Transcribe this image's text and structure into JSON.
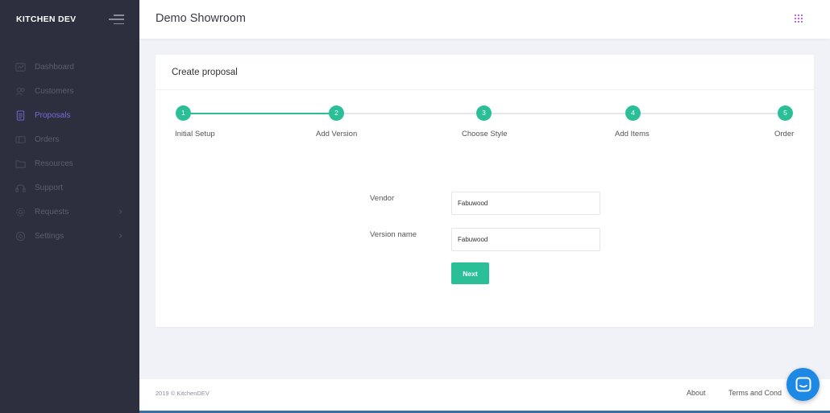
{
  "sidebar": {
    "brand": "KITCHEN DEV",
    "items": [
      {
        "label": "Dashboard",
        "icon": "dashboard-icon"
      },
      {
        "label": "Customers",
        "icon": "users-icon"
      },
      {
        "label": "Proposals",
        "icon": "document-icon",
        "active": true
      },
      {
        "label": "Orders",
        "icon": "cart-icon"
      },
      {
        "label": "Resources",
        "icon": "folder-icon"
      },
      {
        "label": "Support",
        "icon": "support-icon"
      },
      {
        "label": "Requests",
        "icon": "gear-icon",
        "has_submenu": true
      },
      {
        "label": "Settings",
        "icon": "settings-icon",
        "has_submenu": true
      }
    ]
  },
  "topbar": {
    "title": "Demo Showroom",
    "apps_icon": "grid-icon"
  },
  "card": {
    "title": "Create proposal"
  },
  "stepper": {
    "current_step": 2,
    "steps": [
      {
        "number": "1",
        "label": "Initial Setup"
      },
      {
        "number": "2",
        "label": "Add Version"
      },
      {
        "number": "3",
        "label": "Choose Style"
      },
      {
        "number": "4",
        "label": "Add Items"
      },
      {
        "number": "5",
        "label": "Order"
      }
    ]
  },
  "form": {
    "vendor_label": "Vendor",
    "vendor_value": "Fabuwood",
    "version_label": "Version name",
    "version_value": "Fabuwood",
    "next_label": "Next"
  },
  "footer": {
    "copyright": "2019 © KitchenDEV",
    "about": "About",
    "terms": "Terms and Cond"
  },
  "colors": {
    "accent": "#2bbf98",
    "active_nav": "#7c68d8",
    "sidebar_bg": "#2d2f3e",
    "chat": "#1e88e5"
  }
}
